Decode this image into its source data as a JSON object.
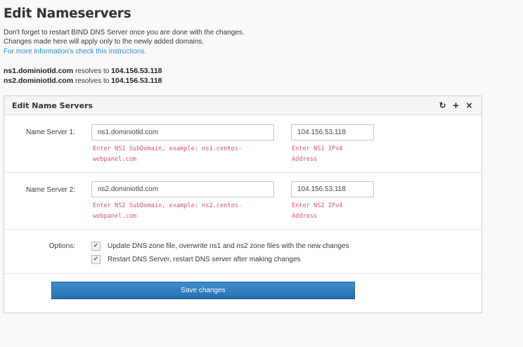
{
  "page": {
    "title": "Edit Nameservers",
    "notes": [
      "Don't forget to restart BIND DNS Server once you are done with the changes.",
      "Changes made here will apply only to the newly added domains."
    ],
    "link_text": "For more information's check this instructions."
  },
  "resolves": [
    {
      "host": "ns1.dominiotld.com",
      "text": "resolves to",
      "ip": "104.156.53.118"
    },
    {
      "host": "ns2.dominiotld.com",
      "text": "resolves to",
      "ip": "104.156.53.118"
    }
  ],
  "panel": {
    "title": "Edit Name Servers",
    "tools": {
      "refresh_icon": "refresh-icon",
      "expand_icon": "plus-icon",
      "close_icon": "close-icon"
    }
  },
  "ns1": {
    "label": "Name Server 1:",
    "host_value": "ns1.dominiotld.com",
    "host_help": "Enter NS1 SubDomain, example: ns1.centos-\nwebpanel.com",
    "ip_value": "104.156.53.118",
    "ip_help": "Enter NS1 IPv4\nAddress"
  },
  "ns2": {
    "label": "Name Server 2:",
    "host_value": "ns2.dominiotld.com",
    "host_help": "Enter NS2 SubDomain, example: ns2.centos-\nwebpanel.com",
    "ip_value": "104.156.53.118",
    "ip_help": "Enter NS2 IPv4\nAddress"
  },
  "options": {
    "label": "Options:",
    "items": [
      {
        "checked": true,
        "label": "Update DNS zone file, overwrite ns1 and ns2 zone files with the new changes"
      },
      {
        "checked": true,
        "label": "Restart DNS Server, restart DNS server after making changes"
      }
    ]
  },
  "submit": {
    "label": "Save changes"
  },
  "colors": {
    "accent": "#2d8bd8",
    "help_text": "#d2527a",
    "button": "#2f78bd"
  }
}
